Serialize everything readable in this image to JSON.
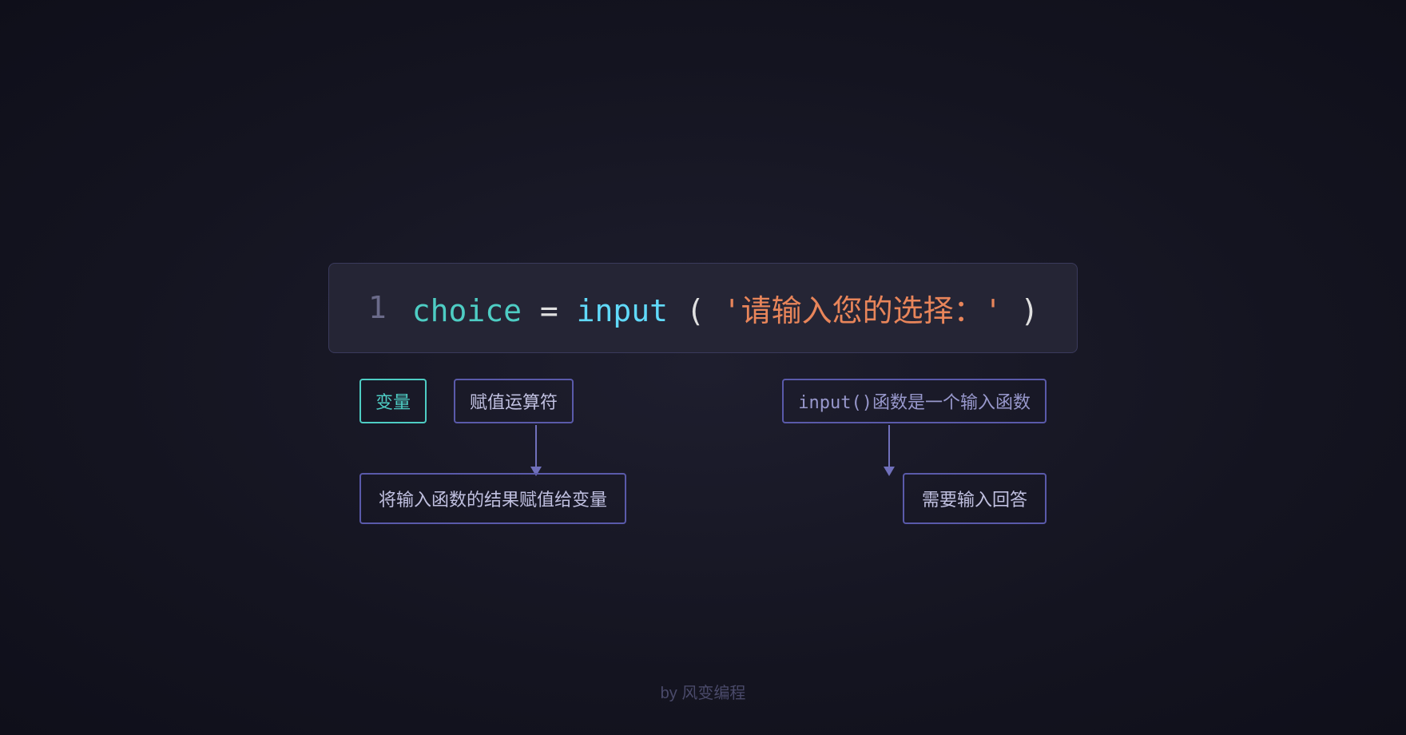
{
  "page": {
    "background_color": "#141420",
    "footer": "by 风变编程"
  },
  "code": {
    "line_number": "1",
    "variable": "choice",
    "operator": " = ",
    "function_name": "input",
    "paren_open": "(",
    "string_value": "'请输入您的选择：'",
    "paren_close": ")"
  },
  "annotations": {
    "label_var": "变量",
    "label_assign": "赋值运算符",
    "label_input": "input()函数是一个输入函数",
    "desc_left": "将输入函数的结果赋值给变量",
    "desc_right": "需要输入回答"
  }
}
